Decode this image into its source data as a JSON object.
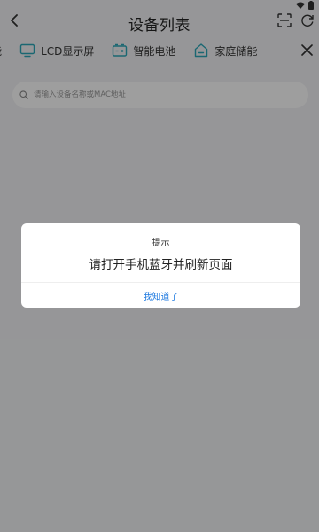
{
  "header": {
    "title": "设备列表"
  },
  "tabs": [
    {
      "label": "能",
      "icon": "partial-tab"
    },
    {
      "label": "LCD显示屏",
      "icon": "monitor-icon"
    },
    {
      "label": "智能电池",
      "icon": "battery-icon"
    },
    {
      "label": "家庭储能",
      "icon": "home-storage-icon"
    }
  ],
  "search": {
    "placeholder": "请输入设备名称或MAC地址"
  },
  "dialog": {
    "title": "提示",
    "message": "请打开手机蓝牙并刷新页面",
    "confirm_label": "我知道了"
  },
  "colors": {
    "accent": "#1f7ae0",
    "icon_teal": "#2aa7b8",
    "overlay": "rgba(0,0,0,0.38)"
  }
}
